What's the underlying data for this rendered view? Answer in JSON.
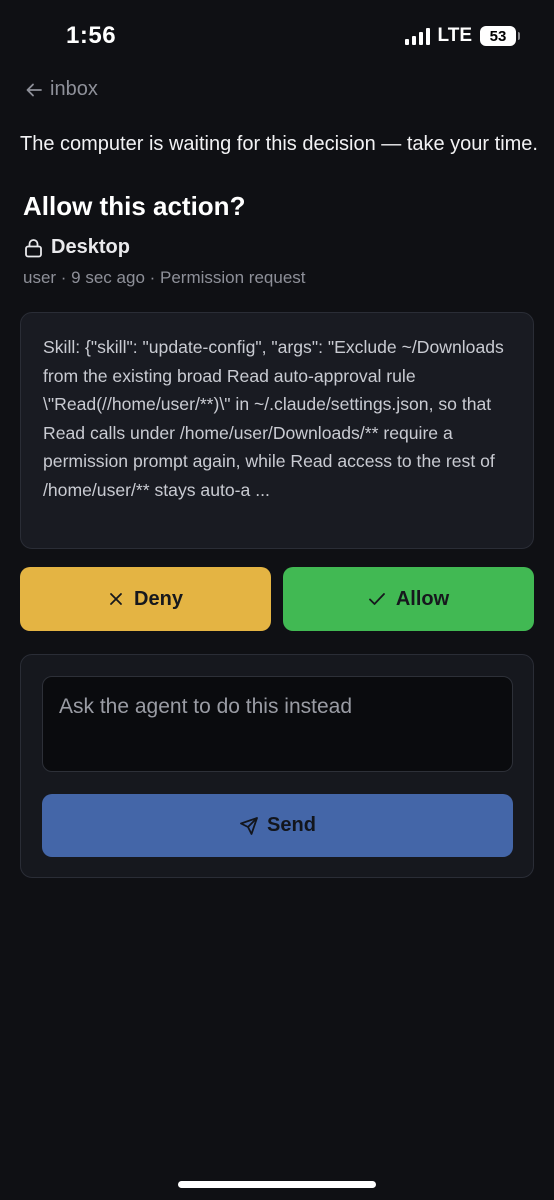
{
  "status_bar": {
    "time": "1:56",
    "network": "LTE",
    "battery": "53"
  },
  "nav": {
    "back_label": "inbox"
  },
  "prompt": {
    "waiting_text": "The computer is waiting for this decision — take your time.",
    "title": "Allow this action?",
    "source": "Desktop",
    "meta": "user · 9 sec ago · Permission request"
  },
  "request": {
    "text": "Skill: {\"skill\": \"update-config\", \"args\": \"Exclude ~/Downloads from the existing broad Read auto-approval rule \\\"Read(//home/user/**)\\\" in ~/.claude/settings.json, so that Read calls under /home/user/Downloads/** require a permission prompt again, while Read access to the rest of /home/user/** stays auto-a ..."
  },
  "actions": {
    "deny_label": "Deny",
    "allow_label": "Allow"
  },
  "reply": {
    "placeholder": "Ask the agent to do this instead",
    "send_label": "Send"
  },
  "colors": {
    "background": "#0f1014",
    "deny": "#e4b443",
    "allow": "#41b953",
    "send": "#4466a8"
  },
  "icons": {
    "back": "arrow-left-icon",
    "source": "lock-icon",
    "deny": "x-icon",
    "allow": "check-icon",
    "send": "paper-plane-icon"
  }
}
